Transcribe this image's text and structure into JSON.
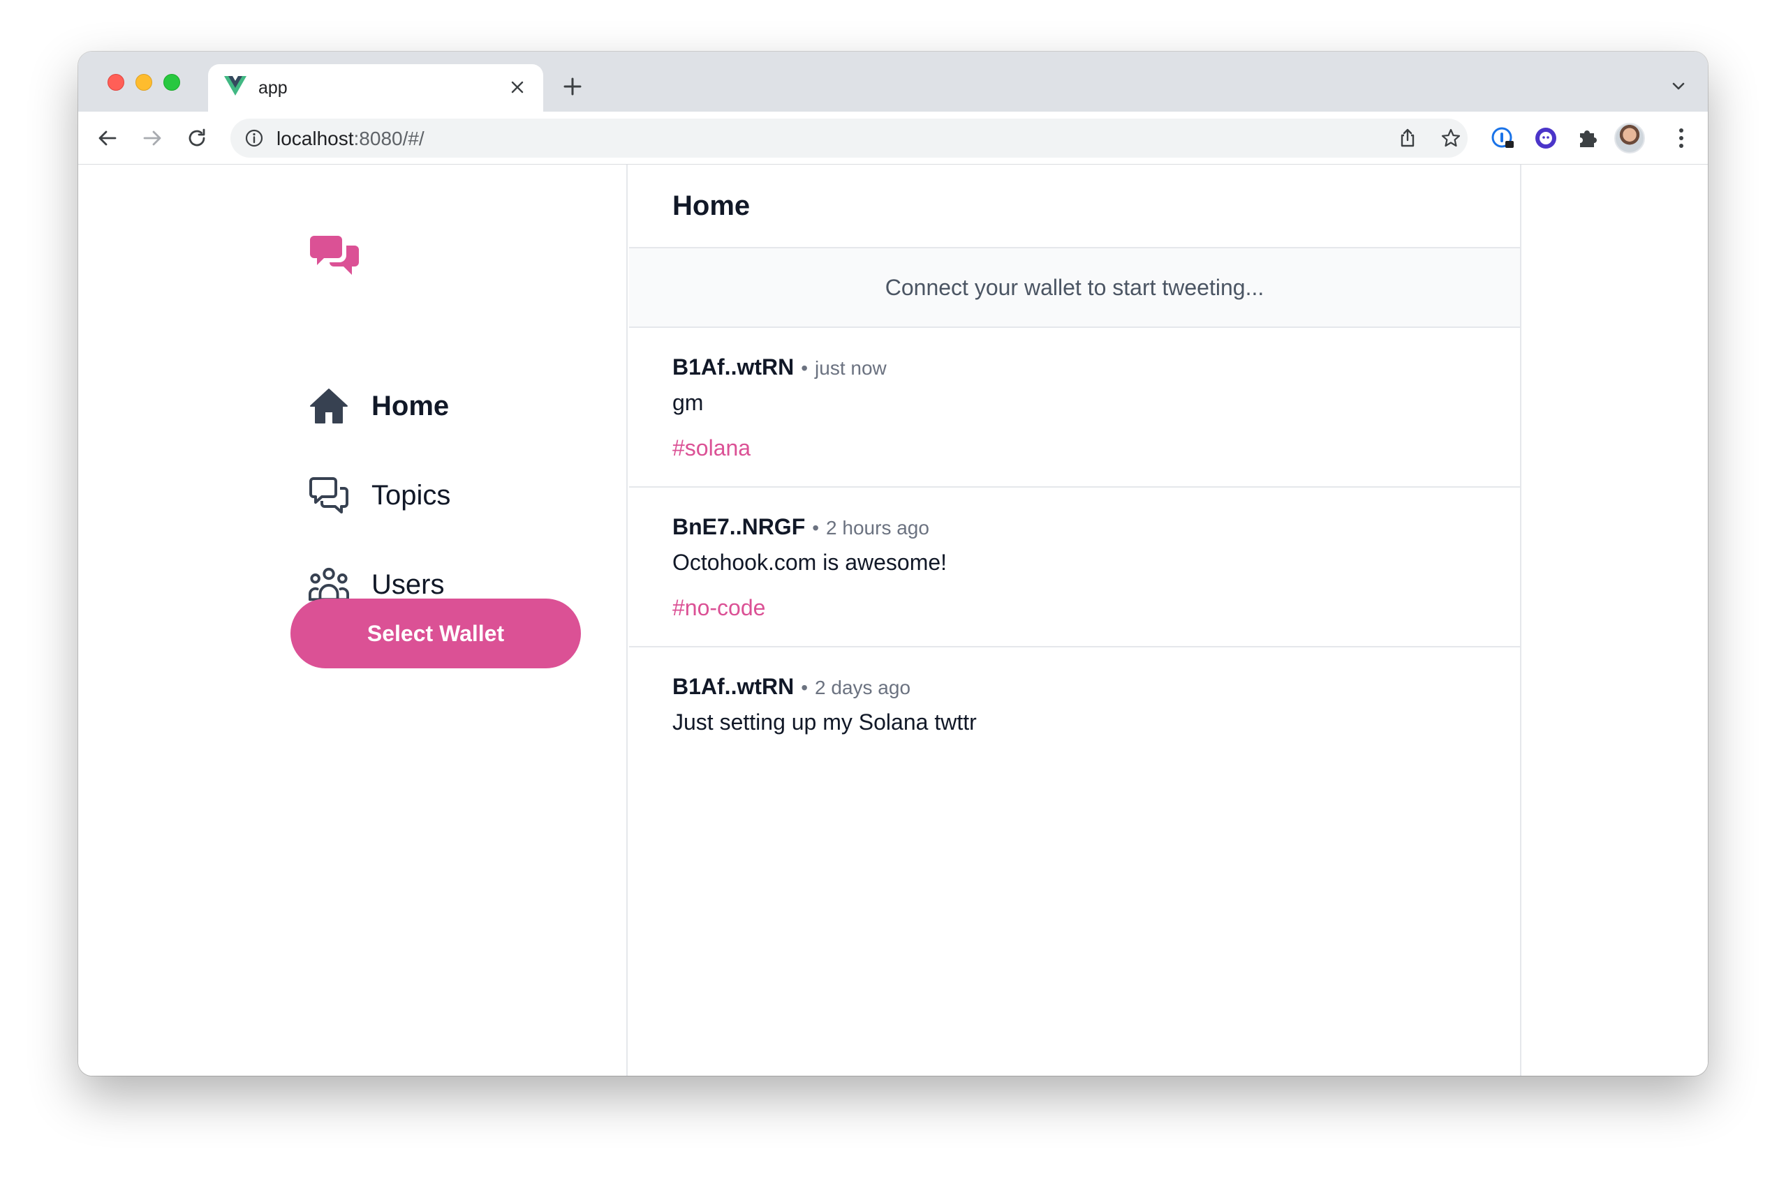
{
  "browser": {
    "tab_title": "app",
    "url_host": "localhost",
    "url_path": ":8080/#/"
  },
  "colors": {
    "accent": "#db5195",
    "text": "#111827",
    "muted": "#6b7280",
    "border": "#e5e7eb"
  },
  "sidebar": {
    "logo_icon": "chat-bubbles-icon",
    "items": [
      {
        "label": "Home",
        "icon": "home-icon",
        "active": true
      },
      {
        "label": "Topics",
        "icon": "chat-alt-icon",
        "active": false
      },
      {
        "label": "Users",
        "icon": "user-group-icon",
        "active": false
      }
    ],
    "wallet_button": "Select Wallet"
  },
  "main": {
    "title": "Home",
    "connect_message": "Connect your wallet to start tweeting...",
    "tweets": [
      {
        "author": "B1Af..wtRN",
        "time": "just now",
        "content": "gm",
        "topic": "#solana"
      },
      {
        "author": "BnE7..NRGF",
        "time": "2 hours ago",
        "content": "Octohook.com is awesome!",
        "topic": "#no-code"
      },
      {
        "author": "B1Af..wtRN",
        "time": "2 days ago",
        "content": "Just setting up my Solana twttr",
        "topic": ""
      }
    ]
  }
}
